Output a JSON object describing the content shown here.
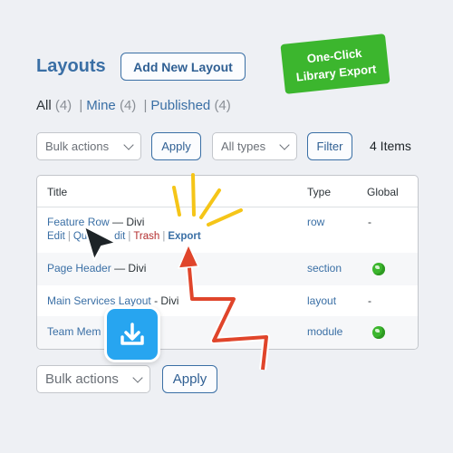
{
  "header": {
    "title": "Layouts",
    "add_new_label": "Add New Layout"
  },
  "promo": {
    "line1": "One-Click",
    "line2": "Library Export",
    "color": "#3cb62e"
  },
  "filters": {
    "all_label": "All",
    "all_count": "(4)",
    "mine_label": "Mine",
    "mine_count": "(4)",
    "published_label": "Published",
    "published_count": "(4)"
  },
  "toolbar": {
    "bulk_actions": "Bulk actions",
    "apply_label": "Apply",
    "types_label": "All types",
    "filter_label": "Filter",
    "items_count": "4 Items"
  },
  "table": {
    "headers": {
      "title": "Title",
      "type": "Type",
      "global": "Global"
    },
    "rows": [
      {
        "title": "Feature Row",
        "suffix": "— Divi",
        "type": "row",
        "global": "-"
      },
      {
        "title": "Page Header",
        "suffix": "— Divi",
        "type": "section",
        "global": "globe-icon"
      },
      {
        "title": "Main Services Layout",
        "suffix": "- Divi",
        "type": "layout",
        "global": "-"
      },
      {
        "title": "Team Mem",
        "suffix": "",
        "type": "module",
        "global": "globe-icon"
      }
    ],
    "row_actions": {
      "edit": "Edit",
      "quick_edit_partial_a": "Qu",
      "quick_edit_partial_b": "dit",
      "trash": "Trash",
      "export": "Export"
    }
  },
  "bottom_toolbar": {
    "bulk_actions": "Bulk actions",
    "apply_label": "Apply"
  },
  "colors": {
    "accent": "#3a6fa5",
    "trash": "#b32d2e",
    "badge_blue": "#27a5f0",
    "arrow_red": "#e0452b",
    "burst_yellow": "#f5c518"
  }
}
